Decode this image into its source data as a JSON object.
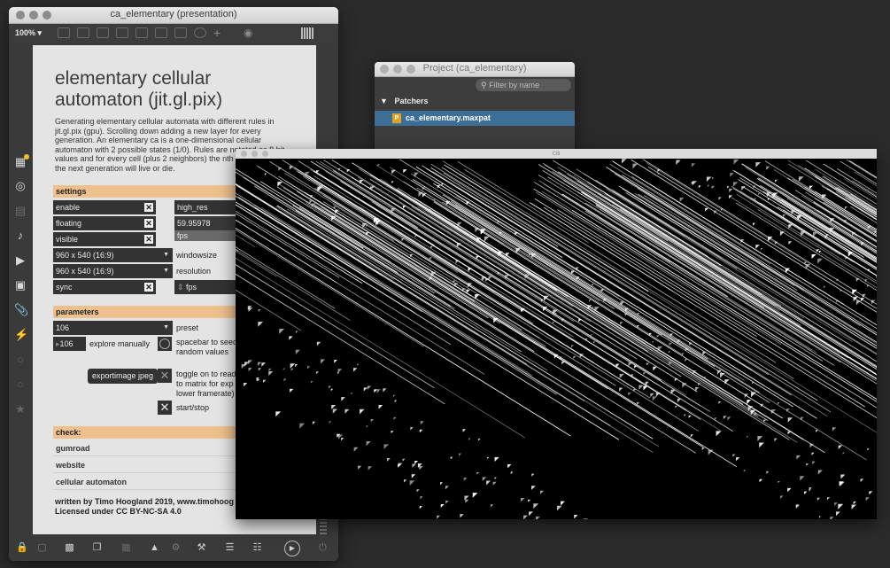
{
  "main_window": {
    "title": "ca_elementary (presentation)",
    "zoom": "100% ▾"
  },
  "patcher": {
    "heading": "elementary cellular automaton (jit.gl.pix)",
    "description": "Generating elementary cellular automata with different rules in jit.gl.pix (gpu). Scrolling down adding a new layer for every generation. An elementary ca is a one-dimensional cellular automaton with 2 possible states (1/0). Rules are notated as 8 bit values and for every cell (plus 2 neighbors) the nth bit determines if the next generation will live or die.",
    "settings": {
      "header": "settings",
      "enable": "enable",
      "floating": "floating",
      "visible": "visible",
      "high_res": "high_res",
      "fps_value": "59.95978",
      "fps_label": "fps",
      "windowsize_value": "960 x 540 (16:9)",
      "windowsize_label": "windowsize",
      "resolution_value": "960 x 540 (16:9)",
      "resolution_label": "resolution",
      "sync": "sync",
      "fps_number_label": "fps"
    },
    "parameters": {
      "header": "parameters",
      "preset_value": "106",
      "preset_label": "preset",
      "explore_value": "106",
      "explore_label": "explore manually",
      "spacebar_label_1": "spacebar to seed",
      "spacebar_label_2": "random values",
      "export_button": "exportimage jpeg",
      "toggle_label_1": "toggle on to read",
      "toggle_label_2": "to matrix for exp",
      "toggle_label_3": "lower framerate)",
      "start_stop": "start/stop"
    },
    "check": {
      "header": "check:",
      "links": [
        "gumroad",
        "website",
        "cellular automaton"
      ]
    },
    "footer_1": "written by Timo Hoogland 2019, www.timohoog",
    "footer_2": "Licensed under CC BY-NC-SA 4.0"
  },
  "project_window": {
    "title": "Project (ca_elementary)",
    "search_placeholder": "Filter by name",
    "group": "Patchers",
    "item": "ca_elementary.maxpat",
    "item_badge": "P"
  },
  "ca_window": {
    "title": "ca"
  },
  "colors": {
    "section_header": "#eec08e",
    "selected_row": "#3d6e96",
    "accent_yellow": "#f0c020"
  }
}
